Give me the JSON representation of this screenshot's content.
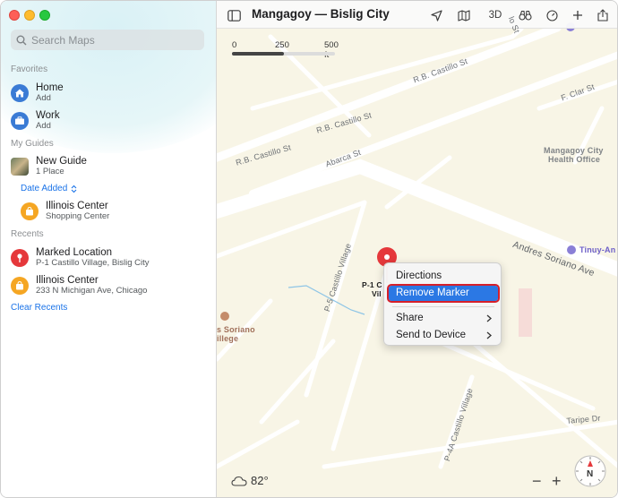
{
  "window": {
    "title": "Mangagoy — Bislig City"
  },
  "sidebar": {
    "search_placeholder": "Search Maps",
    "favorites_title": "Favorites",
    "favorites": [
      {
        "name": "Home",
        "sub": "Add",
        "icon": "house-icon",
        "color": "#3a7bd5"
      },
      {
        "name": "Work",
        "sub": "Add",
        "icon": "briefcase-icon",
        "color": "#3a7bd5"
      }
    ],
    "guides_title": "My Guides",
    "guide": {
      "name": "New Guide",
      "sub": "1 Place"
    },
    "date_added": "Date Added",
    "guide_place": {
      "name": "Illinois Center",
      "sub": "Shopping Center",
      "color": "#f5a623"
    },
    "recents_title": "Recents",
    "recents": [
      {
        "name": "Marked Location",
        "sub": "P-1 Castillo Village, Bislig City",
        "color": "#e5383b"
      },
      {
        "name": "Illinois Center",
        "sub": "233 N Michigan Ave, Chicago",
        "color": "#f5a623"
      }
    ],
    "clear_recents": "Clear Recents"
  },
  "toolbar": {
    "three_d": "3D"
  },
  "scale": {
    "labels": [
      "0",
      "250",
      "500 ft"
    ]
  },
  "map_labels": {
    "rb_castillo_1": "R.B. Castillo St",
    "rb_castillo_2": "R.B. Castillo St",
    "rb_castillo_3": "R.B. Castillo St",
    "abarca": "Abarca St",
    "f_clar": "F. Clar St",
    "mangagoy_health": "Mangagoy City",
    "mangagoy_health2": "Health Office",
    "andres_soriano": "Andres Soriano Ave",
    "tinuy_an": "Tinuy-An",
    "p5_castillo": "P-5 Castillo Village",
    "p4_castillo": "P-4A Castillo Village",
    "p1_label": "P-1 C",
    "p1_label2": "Vil",
    "soriano": "s Soriano",
    "soriano2": "illege",
    "taripe": "Taripe Dr",
    "top_road": "lo St"
  },
  "context_menu": {
    "items": [
      "Directions",
      "Remove Marker",
      "Share",
      "Send to Device"
    ],
    "selected": "Remove Marker"
  },
  "weather": {
    "temp": "82°"
  },
  "zoom": {
    "minus": "−",
    "plus": "+"
  },
  "compass": {
    "label": "N"
  }
}
